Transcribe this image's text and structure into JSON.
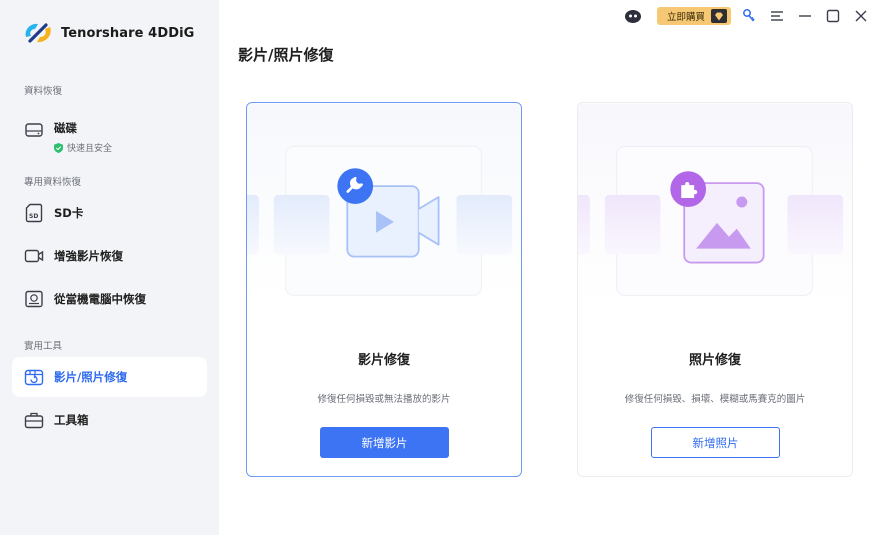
{
  "app": {
    "name": "Tenorshare 4DDiG"
  },
  "sidebar": {
    "sections": [
      {
        "label": "資料恢復"
      },
      {
        "label": "專用資料恢復"
      },
      {
        "label": "實用工具"
      }
    ],
    "disk": {
      "label": "磁碟",
      "sub": "快速且安全"
    },
    "items": [
      {
        "label": "SD卡",
        "icon": "sd-card-icon"
      },
      {
        "label": "增強影片恢復",
        "icon": "video-recovery-icon"
      },
      {
        "label": "從當機電腦中恢復",
        "icon": "crashed-computer-icon"
      },
      {
        "label": "影片/照片修復",
        "icon": "repair-icon",
        "active": true
      },
      {
        "label": "工具箱",
        "icon": "toolbox-icon"
      }
    ]
  },
  "topbar": {
    "buy_label": "立即購買",
    "icons": [
      "assistant-icon",
      "diamond-icon",
      "key-icon",
      "menu-icon",
      "minimize-icon",
      "maximize-icon",
      "close-icon"
    ]
  },
  "main": {
    "title": "影片/照片修復",
    "cards": [
      {
        "title": "影片修復",
        "desc": "修復任何損毀或無法播放的影片",
        "button": "新增影片"
      },
      {
        "title": "照片修復",
        "desc": "修復任何損毀、損壞、模糊或馬賽克的圖片",
        "button": "新增照片"
      }
    ]
  },
  "colors": {
    "accent": "#3c74f4",
    "sidebar_bg": "#f3f4f7",
    "buy_bg": "#f6c873",
    "shield": "#2fbf71",
    "photo_accent": "#b267e8"
  }
}
